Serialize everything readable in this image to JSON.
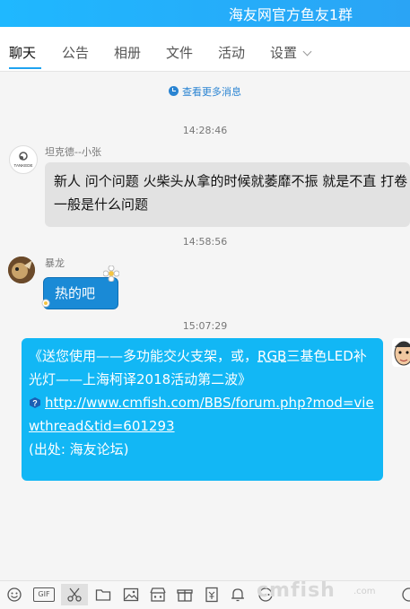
{
  "window": {
    "title": "海友网官方鱼友1群"
  },
  "tabs": [
    {
      "label": "聊天",
      "active": true
    },
    {
      "label": "公告"
    },
    {
      "label": "相册"
    },
    {
      "label": "文件"
    },
    {
      "label": "活动"
    },
    {
      "label": "设置"
    }
  ],
  "history": {
    "label": "查看更多消息"
  },
  "messages": [
    {
      "time": "14:28:46",
      "sender": "坦克德--小张",
      "avatar_text": "TANKEDE",
      "text": "新人 问个问题 火柴头从拿的时候就萎靡不振 就是不直 打卷 一般是什么问题"
    },
    {
      "time": "14:58:56",
      "sender": "暴龙",
      "text": "热的吧"
    },
    {
      "time": "15:07:29",
      "text_part1": "《送您使用——多功能交火支架，或，",
      "text_rgb": "RGB",
      "text_part2": "三基色LED补光灯——上海柯译2018活动第二波》",
      "link": "http://www.cmfish.com/BBS/forum.php?mod=viewthread&tid=601293",
      "source": "(出处: 海友论坛)"
    }
  ],
  "toolbar": {
    "gif_label": "GIF",
    "icons": [
      "emoji-icon",
      "gif-icon",
      "scissors-icon",
      "folder-icon",
      "image-icon",
      "gift-shop-icon",
      "gift-icon",
      "red-packet-icon",
      "bell-icon",
      "more-icon"
    ]
  },
  "watermark": {
    "text": "cmfish",
    "sub": ".com"
  },
  "colors": {
    "accent": "#12b7f5",
    "title_bar": "#1fb8ff"
  }
}
